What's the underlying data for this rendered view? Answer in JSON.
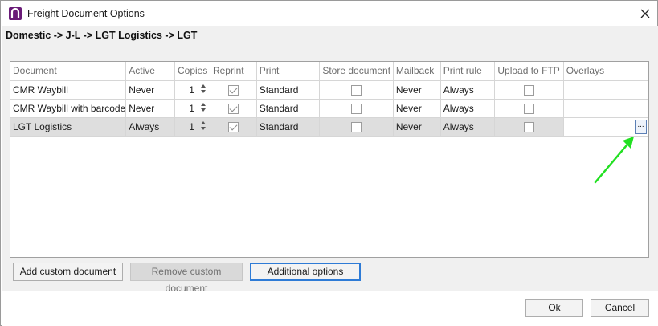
{
  "window": {
    "title": "Freight Document Options",
    "close_icon": "close-icon"
  },
  "route": "Domestic -> J-L -> LGT Logistics -> LGT",
  "table": {
    "columns": [
      "Document",
      "Active",
      "Copies",
      "Reprint",
      "Print",
      "Store document",
      "Mailback",
      "Print rule",
      "Upload to FTP",
      "Overlays"
    ],
    "rows": [
      {
        "document": "CMR Waybill",
        "active": "Never",
        "copies": "1",
        "reprint": true,
        "print": "Standard",
        "store_document": false,
        "mailback": "Never",
        "print_rule": "Always",
        "upload_ftp": false,
        "overlays": ""
      },
      {
        "document": "CMR Waybill with barcode",
        "active": "Never",
        "copies": "1",
        "reprint": true,
        "print": "Standard",
        "store_document": false,
        "mailback": "Never",
        "print_rule": "Always",
        "upload_ftp": false,
        "overlays": ""
      },
      {
        "document": "LGT Logistics",
        "active": "Always",
        "copies": "1",
        "reprint": true,
        "print": "Standard",
        "store_document": false,
        "mailback": "Never",
        "print_rule": "Always",
        "upload_ftp": false,
        "overlays": ""
      }
    ],
    "selected_row": 2,
    "ellipsis_label": "..."
  },
  "buttons": {
    "add_custom": "Add custom document",
    "remove_custom": "Remove custom document",
    "additional_options": "Additional options",
    "ok": "Ok",
    "cancel": "Cancel"
  },
  "annotation": {
    "arrow_color": "#22e022"
  },
  "colors": {
    "app_icon": "#6a1b78",
    "selected_row": "#dedede",
    "focus_border": "#2e7bd6"
  }
}
